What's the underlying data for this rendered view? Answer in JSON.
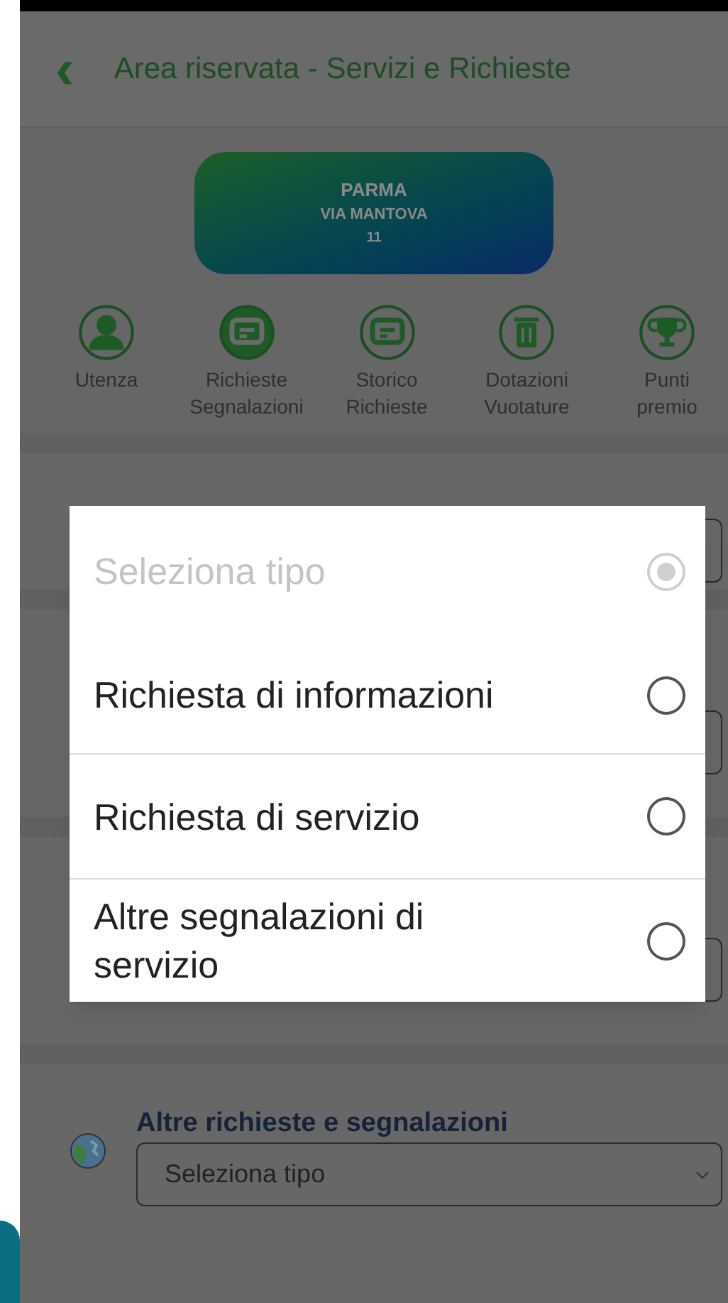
{
  "header": {
    "back_icon": "‹",
    "title": "Area riservata - Servizi e Richieste"
  },
  "address_card": {
    "city": "PARMA",
    "street": "VIA MANTOVA",
    "number": "11"
  },
  "nav": [
    {
      "label": "Utenza",
      "kind": "person",
      "selected": false
    },
    {
      "label": "Richieste Segnalazioni",
      "kind": "ticket",
      "selected": true
    },
    {
      "label": "Storico Richieste",
      "kind": "ticket",
      "selected": false
    },
    {
      "label": "Dotazioni Vuotature",
      "kind": "bin",
      "selected": false
    },
    {
      "label": "Punti premio",
      "kind": "trophy",
      "selected": false
    }
  ],
  "background_sections": [
    {
      "kind": "hidden"
    },
    {
      "kind": "hidden"
    },
    {
      "kind": "hidden"
    },
    {
      "kind": "titled",
      "heading": "Altre richieste e segnalazioni",
      "select": "Seleziona tipo"
    }
  ],
  "dialog": {
    "options": [
      {
        "label": "Seleziona tipo",
        "disabled": true,
        "selected": true
      },
      {
        "label": "Richiesta di informazioni",
        "disabled": false,
        "selected": false
      },
      {
        "label": "Richiesta di servizio",
        "disabled": false,
        "selected": false
      },
      {
        "label": "Altre segnalazioni di servizio",
        "disabled": false,
        "selected": false
      }
    ]
  }
}
